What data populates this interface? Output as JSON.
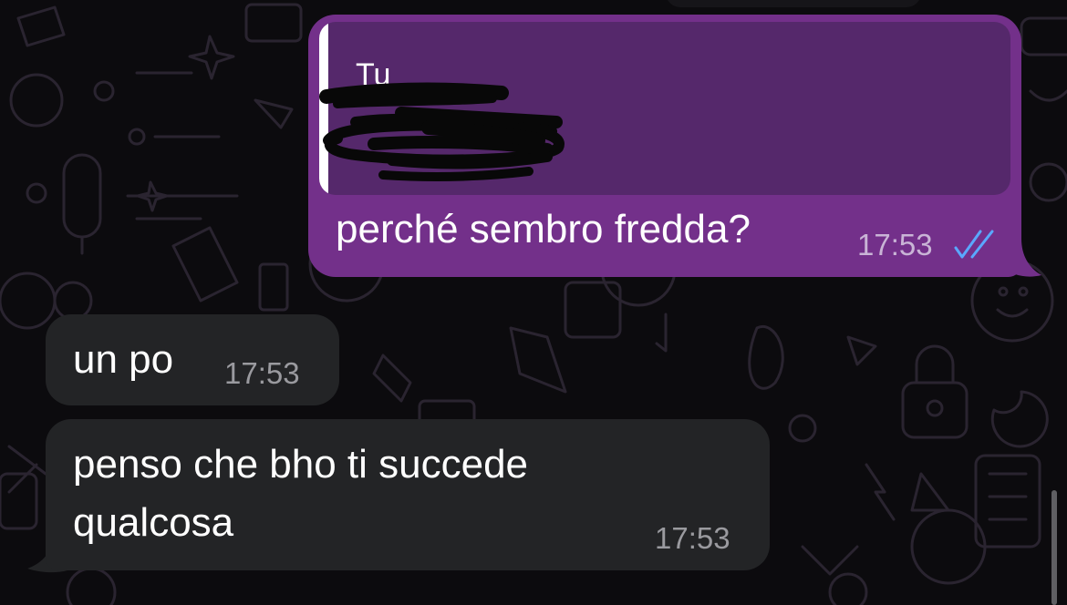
{
  "conversation": {
    "outgoing": [
      {
        "quote_author": "Tu",
        "text": "perché sembro fredda?",
        "time": "17:53",
        "status_icon": "double-check-read-icon"
      }
    ],
    "incoming": [
      {
        "text": "un po",
        "time": "17:53"
      },
      {
        "text": "penso che bho ti succede qualcosa",
        "time": "17:53"
      }
    ]
  },
  "colors": {
    "background": "#0c0b0e",
    "outgoing_bubble": "#73308a",
    "quote_background": "#55286b",
    "incoming_bubble": "#232426",
    "read_ticks": "#5aa8ff",
    "incoming_time": "#9a9a9f",
    "outgoing_time": "#c9b4d6"
  }
}
